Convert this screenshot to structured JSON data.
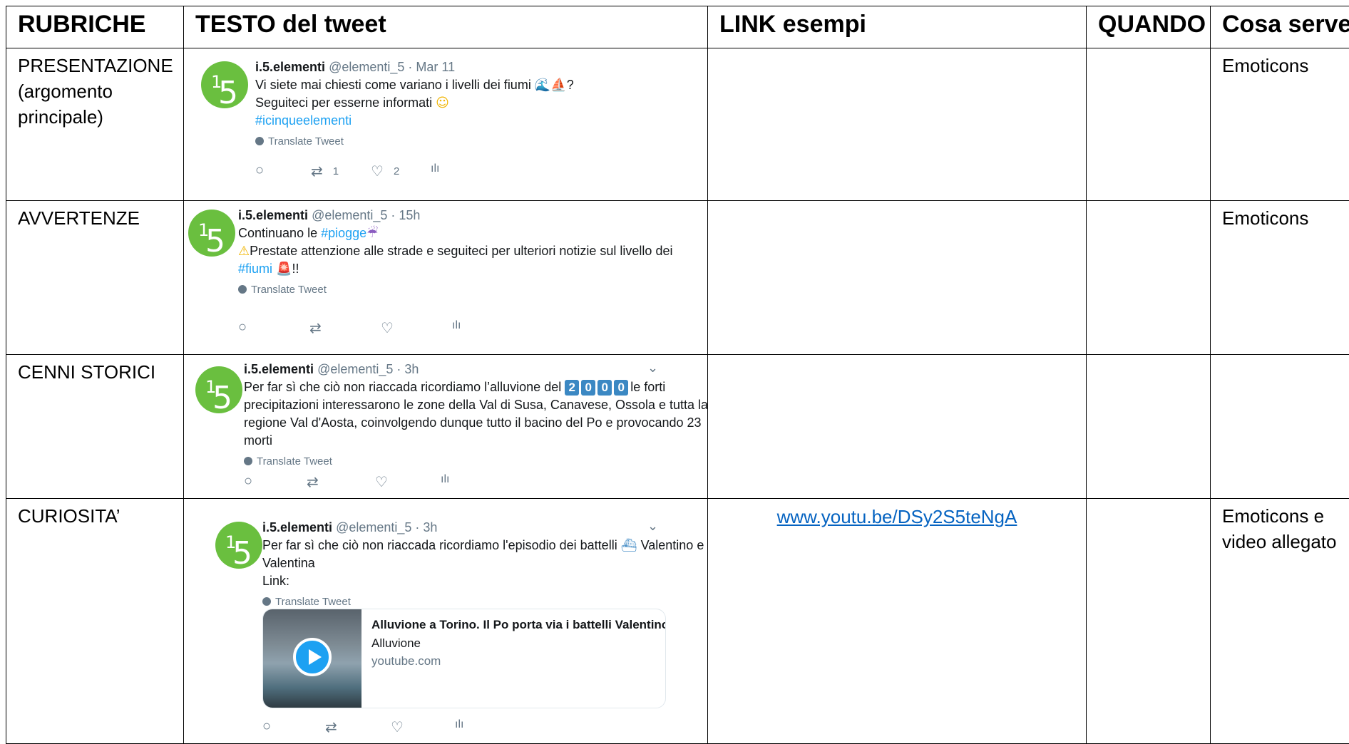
{
  "headers": [
    "RUBRICHE",
    "TESTO del tweet",
    "LINK esempi",
    "QUANDO",
    "Cosa serve"
  ],
  "rows": [
    {
      "rubrica": "PRESENTAZIONE (argomento principale)",
      "tweet": {
        "name": "i.5.elementi",
        "handle": "@elementi_5 · Mar 11",
        "lines": [
          "Vi siete mai chiesti come variano i livelli dei fiumi",
          "Seguiteci per esserne informati"
        ],
        "hashtag": "#icinqueelementi",
        "translate": "Translate Tweet",
        "retweets": "1",
        "likes": "2"
      },
      "link": "",
      "quando": "",
      "cosa_serve": "Emoticons"
    },
    {
      "rubrica": "AVVERTENZE",
      "tweet": {
        "name": "i.5.elementi",
        "handle": "@elementi_5 · 15h",
        "line1_prefix": "Continuano le",
        "line1_hash": "#piogge",
        "line2": "Prestate attenzione alle strade e seguiteci per ulteriori notizie sul livello dei",
        "line3_hash": "#fiumi",
        "line3_suffix": "!!",
        "translate": "Translate Tweet"
      },
      "link": "",
      "quando": "",
      "cosa_serve": "Emoticons"
    },
    {
      "rubrica": "CENNI STORICI",
      "tweet": {
        "name": "i.5.elementi",
        "handle": "@elementi_5 · 3h",
        "line1_prefix": "Per far sì che ciò non riaccada ricordiamo l’alluvione del",
        "year_digits": [
          "2",
          "0",
          "0",
          "0"
        ],
        "line1_suffix": "le forti",
        "line2": "precipitazioni interessarono le zone della Val di Susa, Canavese, Ossola e tutta la",
        "line3": "regione Val d'Aosta, coinvolgendo dunque tutto il bacino del Po e provocando 23",
        "line4": "morti",
        "translate": "Translate Tweet"
      },
      "link": "",
      "quando": "",
      "cosa_serve": ""
    },
    {
      "rubrica": "CURIOSITA’",
      "tweet": {
        "name": "i.5.elementi",
        "handle": "@elementi_5 · 3h",
        "line1_prefix": "Per far sì che ciò non riaccada ricordiamo l'episodio dei battelli",
        "line1_suffix": "Valentino e",
        "line2": "Valentina",
        "line3": "Link:",
        "translate": "Translate Tweet",
        "card_title": "Alluvione a Torino. Il Po porta via i battelli Valentino...",
        "card_sub": "Alluvione",
        "card_domain": "youtube.com"
      },
      "link": "www.youtu.be/DSy2S5teNgA",
      "quando": "",
      "cosa_serve": "Emoticons e video allegato"
    }
  ],
  "icons": [
    "reply-icon",
    "retweet-icon",
    "like-icon",
    "analytics-icon",
    "chevron-down-icon",
    "globe-icon",
    "play-icon"
  ],
  "colors": {
    "avatar": "#6abf3f",
    "hashtag": "#1da1f2",
    "link": "#0563c1",
    "muted": "#657786"
  }
}
